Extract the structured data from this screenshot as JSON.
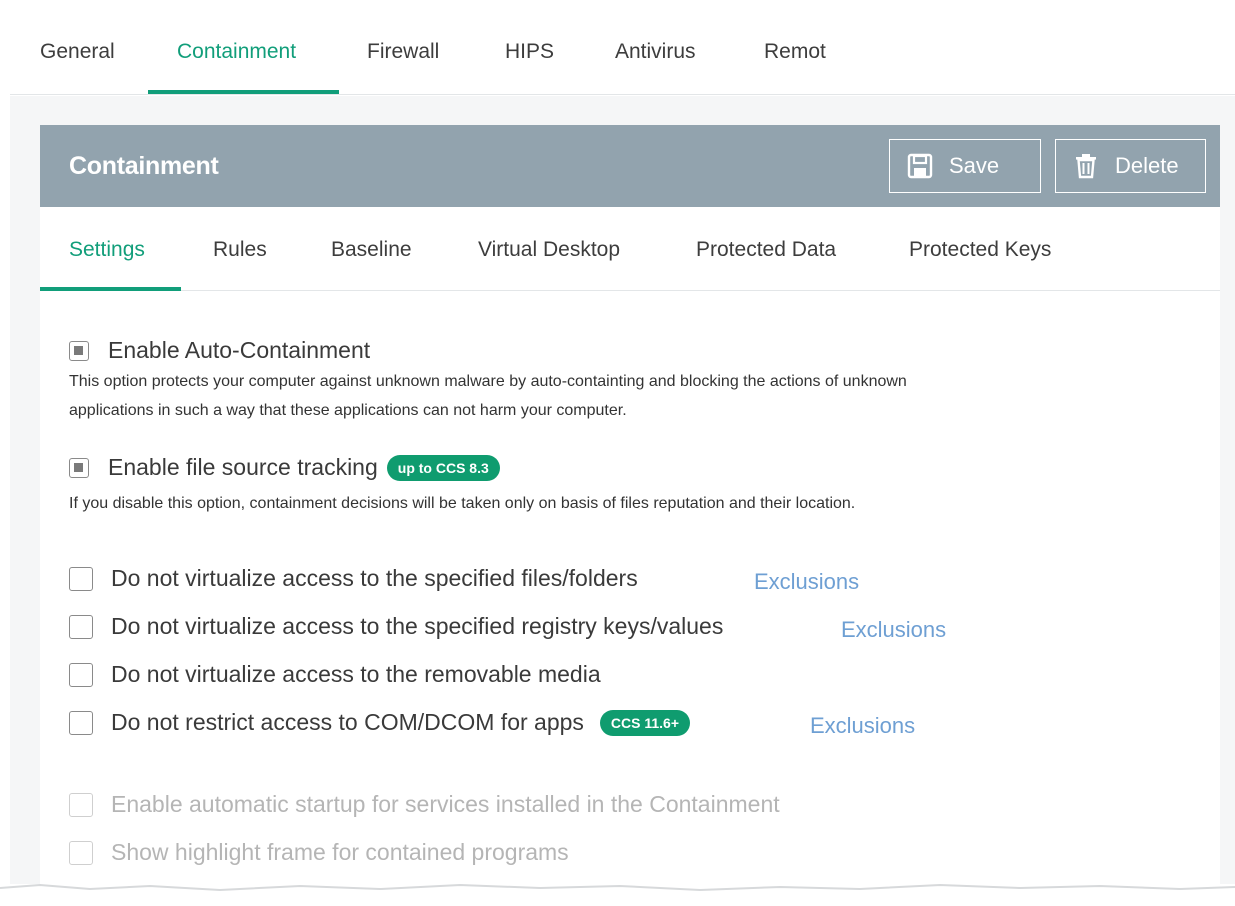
{
  "top_tabs": [
    {
      "label": "General"
    },
    {
      "label": "Containment"
    },
    {
      "label": "Firewall"
    },
    {
      "label": "HIPS"
    },
    {
      "label": "Antivirus"
    },
    {
      "label": "Remot"
    }
  ],
  "active_top_tab": "Containment",
  "panel": {
    "title": "Containment",
    "save_label": "Save",
    "delete_label": "Delete"
  },
  "sub_tabs": [
    {
      "label": "Settings"
    },
    {
      "label": "Rules"
    },
    {
      "label": "Baseline"
    },
    {
      "label": "Virtual Desktop"
    },
    {
      "label": "Protected Data"
    },
    {
      "label": "Protected Keys"
    }
  ],
  "active_sub_tab": "Settings",
  "settings": {
    "auto_containment": {
      "label": "Enable Auto-Containment",
      "state": "partial",
      "description_line1": "This option protects your computer against unknown malware by auto-containting and blocking the actions of unknown",
      "description_line2": "applications in such a way that these applications can not harm your computer."
    },
    "file_source_tracking": {
      "label": "Enable file source tracking",
      "state": "partial",
      "badge": "up to CCS 8.3",
      "description": "If you disable this option, containment decisions will be taken only on basis of files reputation and their location."
    },
    "options": [
      {
        "label": "Do not virtualize access to the specified files/folders",
        "link": "Exclusions",
        "checked": false
      },
      {
        "label": "Do not virtualize access to the specified registry keys/values",
        "link": "Exclusions",
        "checked": false
      },
      {
        "label": "Do not virtualize access to the removable media",
        "checked": false
      },
      {
        "label": "Do not restrict access to COM/DCOM for apps",
        "badge": "CCS 11.6+",
        "link": "Exclusions",
        "checked": false
      }
    ],
    "disabled_options": [
      {
        "label": "Enable automatic startup for services installed in the Containment",
        "checked": false
      },
      {
        "label": "Show highlight frame for contained programs",
        "checked": false
      }
    ]
  },
  "colors": {
    "accent": "#119e7a",
    "header_bg": "#92a3ae",
    "badge_bg": "#0f9c6f",
    "link": "#6e9fd3"
  },
  "icons": {
    "save": "floppy-disk-icon",
    "delete": "trash-can-icon"
  }
}
